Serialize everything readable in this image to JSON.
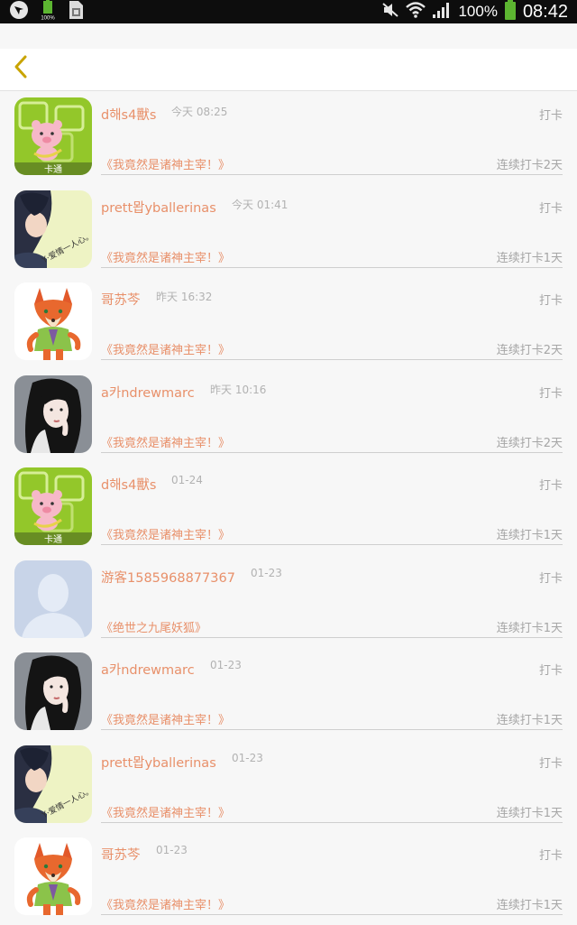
{
  "status_bar": {
    "battery": "100%",
    "time": "08:42",
    "icons": [
      "notification-icon",
      "battery-small-icon",
      "sim-icon",
      "mute-icon",
      "wifi-icon",
      "signal-icon",
      "battery-icon"
    ]
  },
  "header": {
    "back_icon": "chevron-left-icon"
  },
  "colors": {
    "accent": "#e8906a",
    "muted": "#a6a6a6",
    "back": "#c9a400"
  },
  "items": [
    {
      "name": "d해s4獸s",
      "time": "今天 08:25",
      "action": "打卡",
      "book": "《我竟然是诸神主宰！》",
      "streak": "连续打卡2天",
      "avatar": "pig-cartoon",
      "avatar_caption": "卡通"
    },
    {
      "name": "prett뫕yballerinas",
      "time": "今天 01:41",
      "action": "打卡",
      "book": "《我竟然是诸神主宰！》",
      "streak": "连续打卡1天",
      "avatar": "boy-portrait"
    },
    {
      "name": "哥苏芩",
      "time": "昨天 16:32",
      "action": "打卡",
      "book": "《我竟然是诸神主宰！》",
      "streak": "连续打卡2天",
      "avatar": "fox-cartoon"
    },
    {
      "name": "a카ndrewmarc",
      "time": "昨天 10:16",
      "action": "打卡",
      "book": "《我竟然是诸神主宰！》",
      "streak": "连续打卡2天",
      "avatar": "girl-portrait"
    },
    {
      "name": "d해s4獸s",
      "time": "01-24",
      "action": "打卡",
      "book": "《我竟然是诸神主宰！》",
      "streak": "连续打卡1天",
      "avatar": "pig-cartoon",
      "avatar_caption": "卡通"
    },
    {
      "name": "游客1585968877367",
      "time": "01-23",
      "action": "打卡",
      "book": "《绝世之九尾妖狐》",
      "streak": "连续打卡1天",
      "avatar": "default-avatar"
    },
    {
      "name": "a카ndrewmarc",
      "time": "01-23",
      "action": "打卡",
      "book": "《我竟然是诸神主宰！》",
      "streak": "连续打卡1天",
      "avatar": "girl-portrait"
    },
    {
      "name": "prett뫕yballerinas",
      "time": "01-23",
      "action": "打卡",
      "book": "《我竟然是诸神主宰！》",
      "streak": "连续打卡1天",
      "avatar": "boy-portrait"
    },
    {
      "name": "哥苏芩",
      "time": "01-23",
      "action": "打卡",
      "book": "《我竟然是诸神主宰！》",
      "streak": "连续打卡1天",
      "avatar": "fox-cartoon"
    }
  ]
}
